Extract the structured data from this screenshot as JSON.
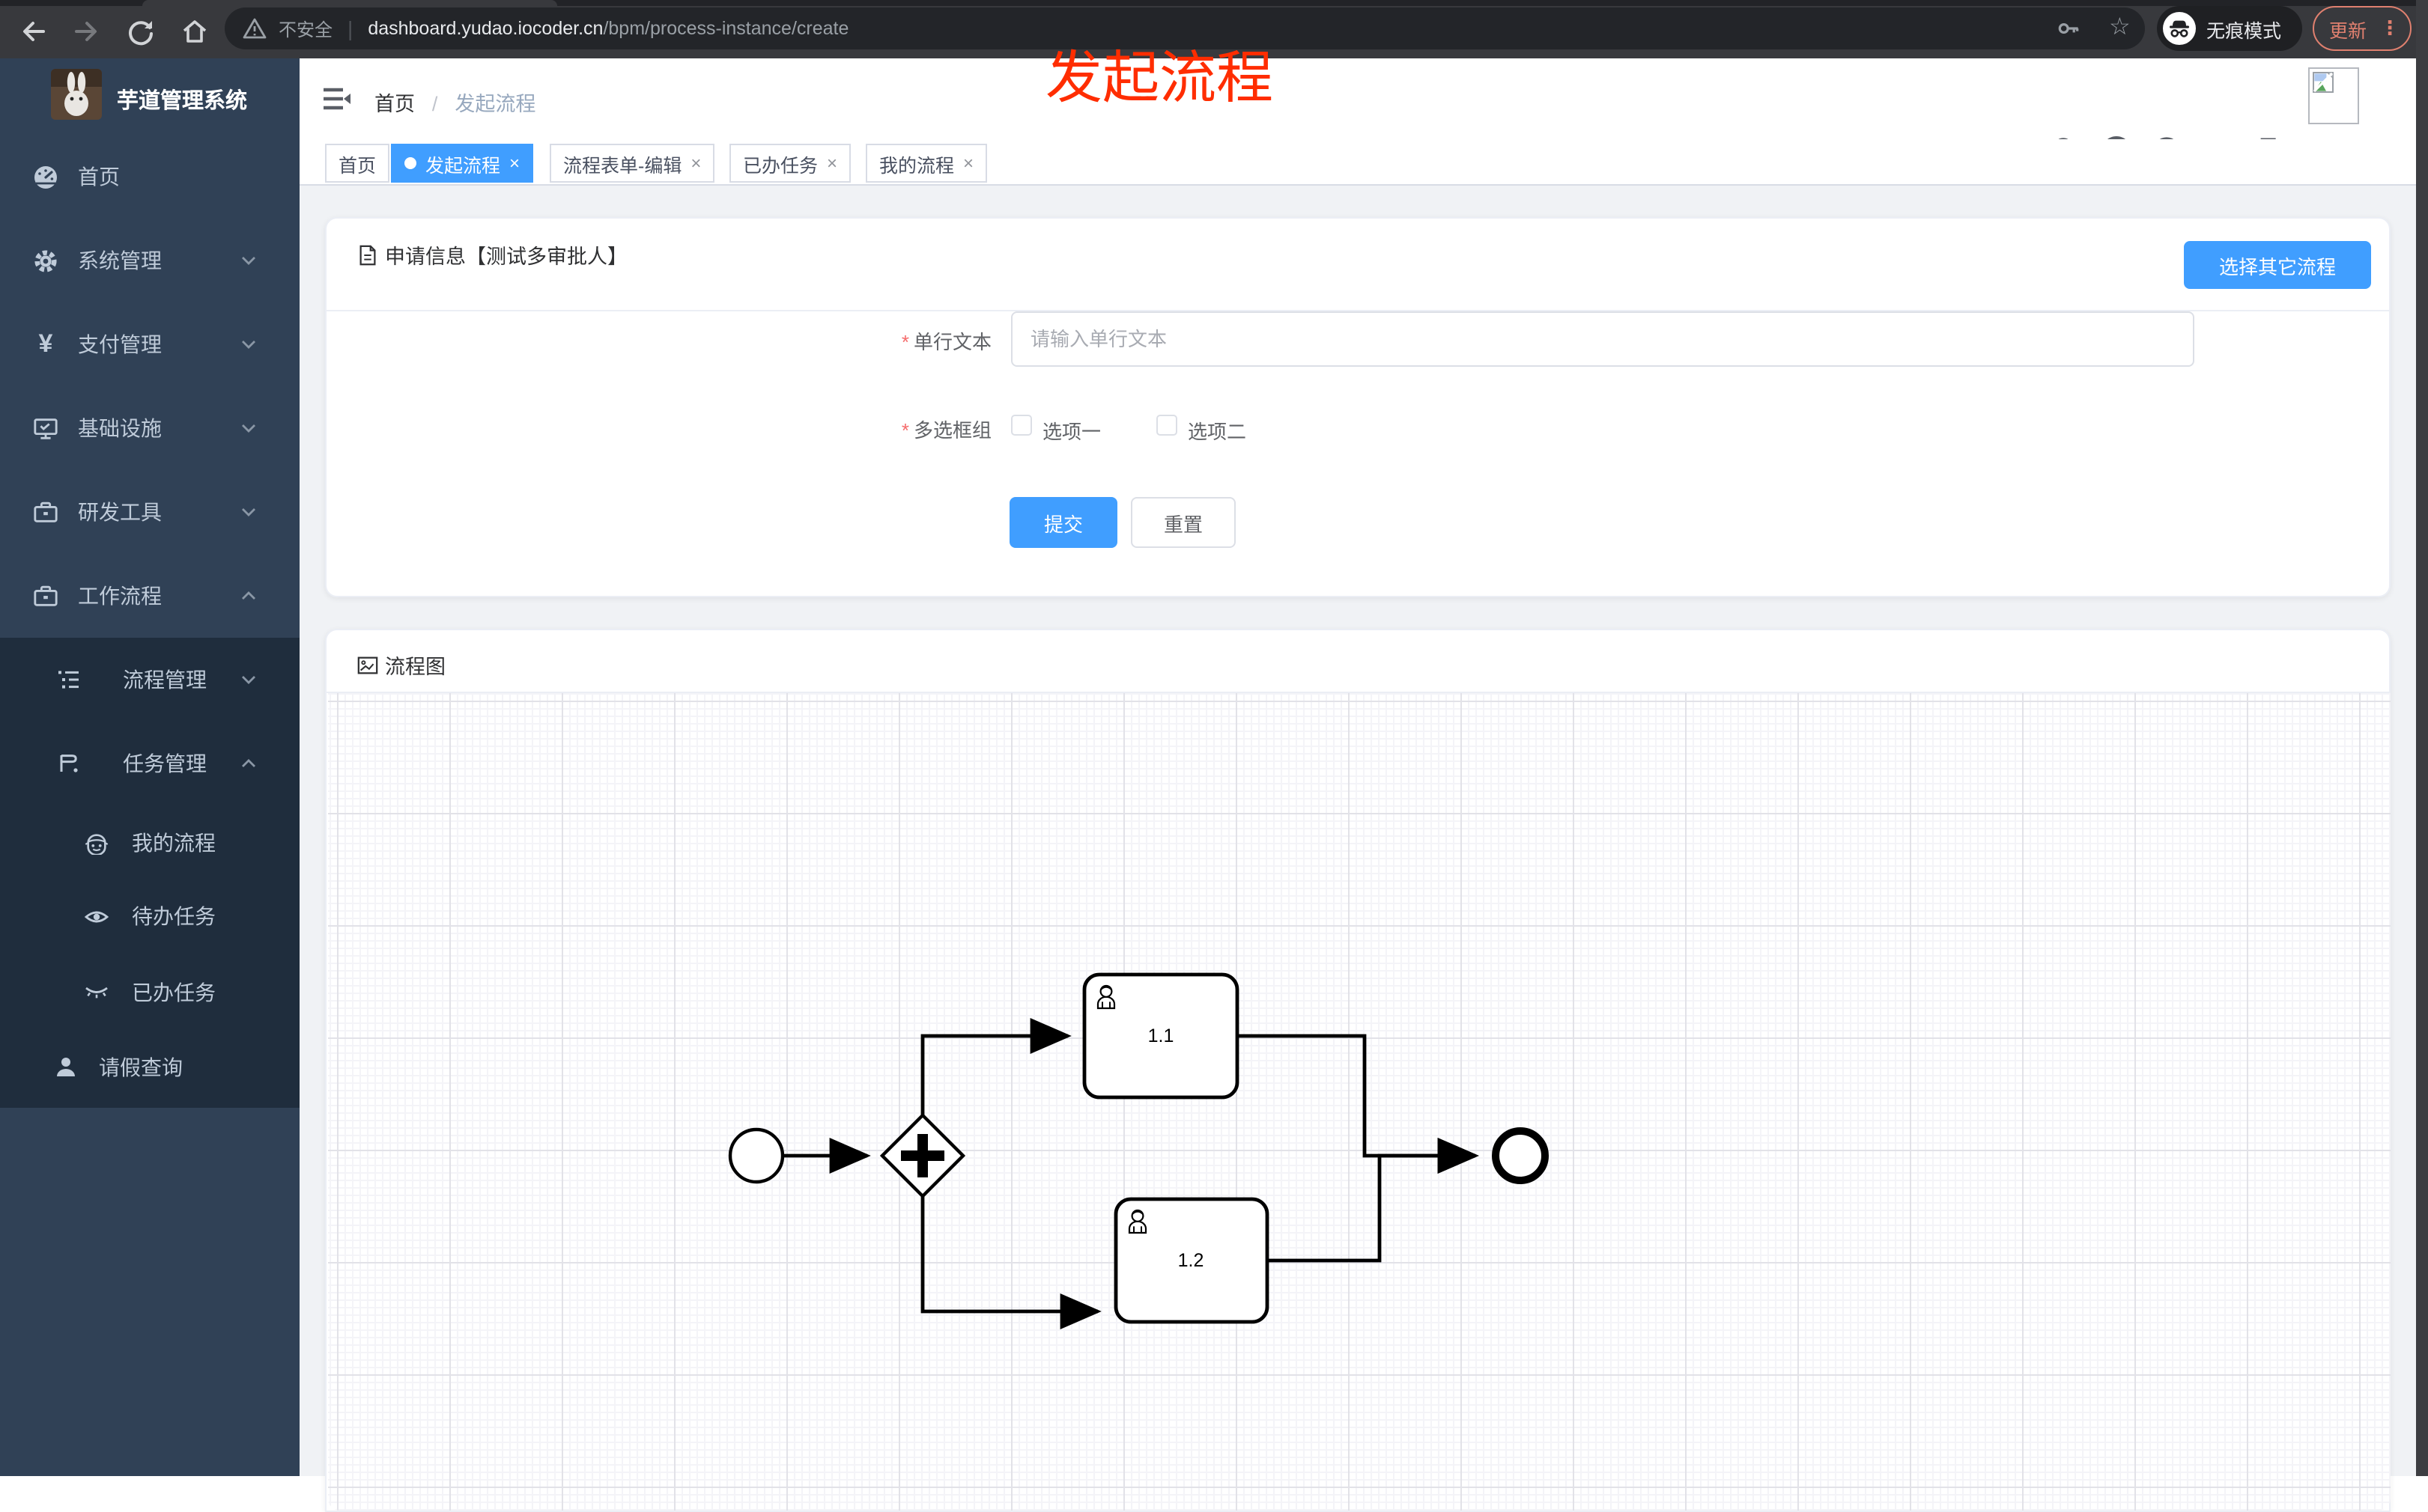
{
  "browser": {
    "security_label": "不安全",
    "url_domain": "dashboard.yudao.iocoder.cn",
    "url_path": "/bpm/process-instance/create",
    "incognito_label": "无痕模式",
    "update_label": "更新",
    "menu_dots": "⋮",
    "star_glyph": "☆"
  },
  "annotation": {
    "text": "发起流程"
  },
  "sidebar": {
    "title": "芋道管理系统",
    "items": [
      {
        "label": "首页"
      },
      {
        "label": "系统管理",
        "chevron": "down"
      },
      {
        "label": "支付管理",
        "chevron": "down"
      },
      {
        "label": "基础设施",
        "chevron": "down"
      },
      {
        "label": "研发工具",
        "chevron": "down"
      },
      {
        "label": "工作流程",
        "chevron": "up"
      }
    ],
    "workflow_children": [
      {
        "label": "流程管理",
        "chevron": "down"
      },
      {
        "label": "任务管理",
        "chevron": "up"
      },
      {
        "label": "我的流程"
      },
      {
        "label": "待办任务"
      },
      {
        "label": "已办任务"
      },
      {
        "label": "请假查询"
      }
    ]
  },
  "header": {
    "breadcrumb_home": "首页",
    "breadcrumb_sep": "/",
    "breadcrumb_current": "发起流程"
  },
  "tabs": {
    "close_glyph": "×",
    "items": [
      {
        "label": "首页",
        "active": false,
        "closable": false
      },
      {
        "label": "发起流程",
        "active": true,
        "closable": true
      },
      {
        "label": "流程表单-编辑",
        "active": false,
        "closable": true
      },
      {
        "label": "已办任务",
        "active": false,
        "closable": true
      },
      {
        "label": "我的流程",
        "active": false,
        "closable": true
      }
    ]
  },
  "form_card": {
    "title": "申请信息【测试多审批人】",
    "select_other_button": "选择其它流程",
    "required_mark": "*",
    "text_field": {
      "label": "单行文本",
      "placeholder": "请输入单行文本",
      "value": ""
    },
    "checkbox_group": {
      "label": "多选框组",
      "options": [
        {
          "label": "选项一",
          "checked": false
        },
        {
          "label": "选项二",
          "checked": false
        }
      ]
    },
    "submit_button": "提交",
    "reset_button": "重置"
  },
  "flow_card": {
    "title": "流程图",
    "diagram": {
      "type": "bpmn",
      "elements": [
        "start-event",
        "parallel-gateway",
        "user-task",
        "user-task",
        "end-event"
      ],
      "tasks": [
        {
          "label": "1.1"
        },
        {
          "label": "1.2"
        }
      ]
    }
  },
  "colors": {
    "accent": "#409eff",
    "annotation": "#ff2d00",
    "sidebar_bg": "#304156",
    "sidebar_submenu_bg": "#1f2d3d",
    "chrome_toolbar": "#38393d",
    "update_chip": "#e0806f"
  }
}
